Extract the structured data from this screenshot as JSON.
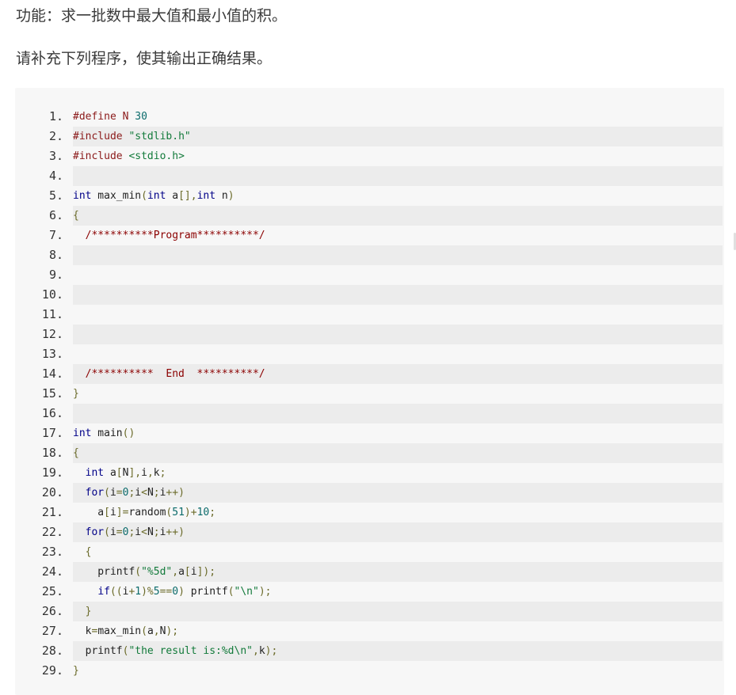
{
  "question": {
    "function_text": "功能：求一批数中最大值和最小值的积。",
    "instruction_text": "请补充下列程序，使其输出正确结果。"
  },
  "code": {
    "lines": [
      [
        {
          "t": "#define N ",
          "c": "pp"
        },
        {
          "t": "30",
          "c": "num"
        }
      ],
      [
        {
          "t": "#include ",
          "c": "pp"
        },
        {
          "t": "\"stdlib.h\"",
          "c": "str"
        }
      ],
      [
        {
          "t": "#include ",
          "c": "pp"
        },
        {
          "t": "<stdio.h>",
          "c": "str"
        }
      ],
      [],
      [
        {
          "t": "int",
          "c": "kw"
        },
        {
          "t": " max_min",
          "c": "id"
        },
        {
          "t": "(",
          "c": "br"
        },
        {
          "t": "int",
          "c": "kw"
        },
        {
          "t": " a",
          "c": "id"
        },
        {
          "t": "[],",
          "c": "br"
        },
        {
          "t": "int",
          "c": "kw"
        },
        {
          "t": " n",
          "c": "id"
        },
        {
          "t": ")",
          "c": "br"
        }
      ],
      [
        {
          "t": "{",
          "c": "br"
        }
      ],
      [
        {
          "t": "  /**********Program**********/",
          "c": "com"
        }
      ],
      [],
      [],
      [],
      [],
      [],
      [],
      [
        {
          "t": "  /**********  End  **********/",
          "c": "com"
        }
      ],
      [
        {
          "t": "}",
          "c": "br"
        }
      ],
      [],
      [
        {
          "t": "int",
          "c": "kw"
        },
        {
          "t": " main",
          "c": "id"
        },
        {
          "t": "()",
          "c": "br"
        }
      ],
      [
        {
          "t": "{",
          "c": "br"
        }
      ],
      [
        {
          "t": "  ",
          "c": "id"
        },
        {
          "t": "int",
          "c": "kw"
        },
        {
          "t": " a",
          "c": "id"
        },
        {
          "t": "[",
          "c": "br"
        },
        {
          "t": "N",
          "c": "id"
        },
        {
          "t": "],",
          "c": "br"
        },
        {
          "t": "i",
          "c": "id"
        },
        {
          "t": ",",
          "c": "br"
        },
        {
          "t": "k",
          "c": "id"
        },
        {
          "t": ";",
          "c": "br"
        }
      ],
      [
        {
          "t": "  ",
          "c": "id"
        },
        {
          "t": "for",
          "c": "kw"
        },
        {
          "t": "(",
          "c": "br"
        },
        {
          "t": "i",
          "c": "id"
        },
        {
          "t": "=",
          "c": "br"
        },
        {
          "t": "0",
          "c": "num"
        },
        {
          "t": ";",
          "c": "br"
        },
        {
          "t": "i",
          "c": "id"
        },
        {
          "t": "<",
          "c": "br"
        },
        {
          "t": "N",
          "c": "id"
        },
        {
          "t": ";",
          "c": "br"
        },
        {
          "t": "i",
          "c": "id"
        },
        {
          "t": "++)",
          "c": "br"
        }
      ],
      [
        {
          "t": "    a",
          "c": "id"
        },
        {
          "t": "[",
          "c": "br"
        },
        {
          "t": "i",
          "c": "id"
        },
        {
          "t": "]=",
          "c": "br"
        },
        {
          "t": "random",
          "c": "id"
        },
        {
          "t": "(",
          "c": "br"
        },
        {
          "t": "51",
          "c": "num"
        },
        {
          "t": ")+",
          "c": "br"
        },
        {
          "t": "10",
          "c": "num"
        },
        {
          "t": ";",
          "c": "br"
        }
      ],
      [
        {
          "t": "  ",
          "c": "id"
        },
        {
          "t": "for",
          "c": "kw"
        },
        {
          "t": "(",
          "c": "br"
        },
        {
          "t": "i",
          "c": "id"
        },
        {
          "t": "=",
          "c": "br"
        },
        {
          "t": "0",
          "c": "num"
        },
        {
          "t": ";",
          "c": "br"
        },
        {
          "t": "i",
          "c": "id"
        },
        {
          "t": "<",
          "c": "br"
        },
        {
          "t": "N",
          "c": "id"
        },
        {
          "t": ";",
          "c": "br"
        },
        {
          "t": "i",
          "c": "id"
        },
        {
          "t": "++)",
          "c": "br"
        }
      ],
      [
        {
          "t": "  {",
          "c": "br"
        }
      ],
      [
        {
          "t": "    printf",
          "c": "id"
        },
        {
          "t": "(",
          "c": "br"
        },
        {
          "t": "\"%5d\"",
          "c": "str"
        },
        {
          "t": ",",
          "c": "br"
        },
        {
          "t": "a",
          "c": "id"
        },
        {
          "t": "[",
          "c": "br"
        },
        {
          "t": "i",
          "c": "id"
        },
        {
          "t": "]);",
          "c": "br"
        }
      ],
      [
        {
          "t": "    ",
          "c": "id"
        },
        {
          "t": "if",
          "c": "kw"
        },
        {
          "t": "((",
          "c": "br"
        },
        {
          "t": "i",
          "c": "id"
        },
        {
          "t": "+",
          "c": "br"
        },
        {
          "t": "1",
          "c": "num"
        },
        {
          "t": ")%",
          "c": "br"
        },
        {
          "t": "5",
          "c": "num"
        },
        {
          "t": "==",
          "c": "br"
        },
        {
          "t": "0",
          "c": "num"
        },
        {
          "t": ") ",
          "c": "br"
        },
        {
          "t": "printf",
          "c": "id"
        },
        {
          "t": "(",
          "c": "br"
        },
        {
          "t": "\"\\n\"",
          "c": "str"
        },
        {
          "t": ");",
          "c": "br"
        }
      ],
      [
        {
          "t": "  }",
          "c": "br"
        }
      ],
      [
        {
          "t": "  k",
          "c": "id"
        },
        {
          "t": "=",
          "c": "br"
        },
        {
          "t": "max_min",
          "c": "id"
        },
        {
          "t": "(",
          "c": "br"
        },
        {
          "t": "a",
          "c": "id"
        },
        {
          "t": ",",
          "c": "br"
        },
        {
          "t": "N",
          "c": "id"
        },
        {
          "t": ");",
          "c": "br"
        }
      ],
      [
        {
          "t": "  printf",
          "c": "id"
        },
        {
          "t": "(",
          "c": "br"
        },
        {
          "t": "\"the result is:%d\\n\"",
          "c": "str"
        },
        {
          "t": ",",
          "c": "br"
        },
        {
          "t": "k",
          "c": "id"
        },
        {
          "t": ");",
          "c": "br"
        }
      ],
      [
        {
          "t": "}",
          "c": "br"
        }
      ]
    ]
  },
  "colors": {
    "keyword": "#000088",
    "preprocessor": "#8b1a1a",
    "string": "#127a3a",
    "comment": "#8b0000",
    "number": "#0b6b6b",
    "punctuation": "#6b6b2a",
    "code_background": "#f7f7f7",
    "alt_row_background": "#ececec"
  }
}
